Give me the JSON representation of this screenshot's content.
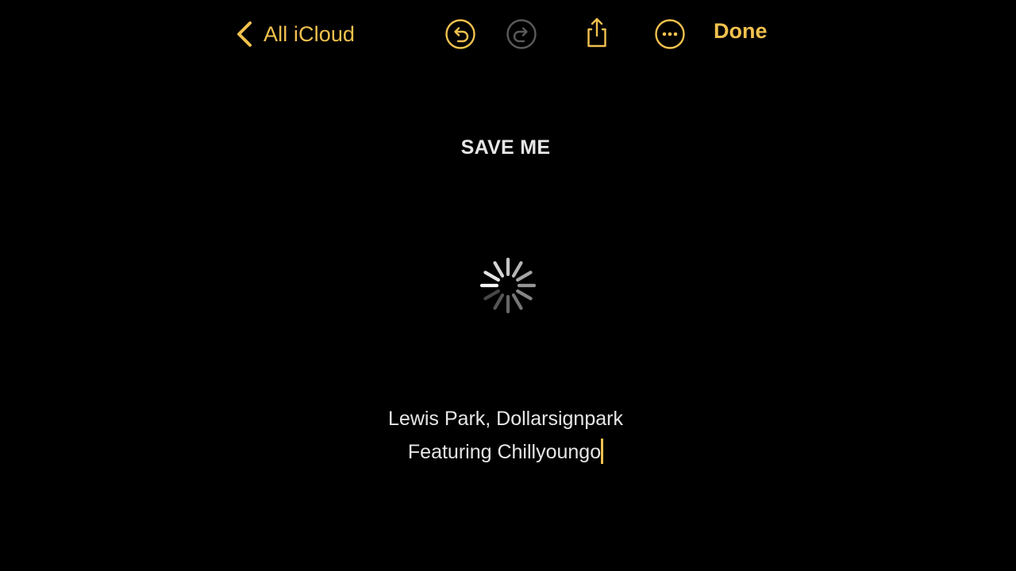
{
  "toolbar": {
    "back_label": "All iCloud",
    "done_label": "Done",
    "accent_color": "#F2C14E",
    "disabled_color": "#5A5A5A",
    "icons": [
      "chevron-left-icon",
      "undo-icon",
      "redo-icon",
      "share-icon",
      "more-icon"
    ]
  },
  "note": {
    "title": "SAVE ME",
    "line1": "Lewis Park, Dollarsignpark",
    "line2": "Featuring Chillyoungo"
  },
  "status": {
    "loading_indicator": "spinner-icon"
  }
}
